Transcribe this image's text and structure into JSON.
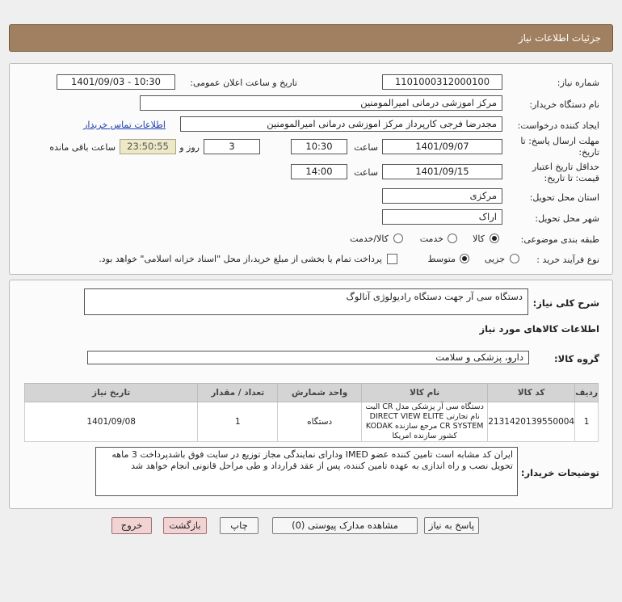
{
  "header": {
    "title": "جزئیات اطلاعات نیاز"
  },
  "form": {
    "need_number_label": "شماره نیاز:",
    "need_number": "1101000312000100",
    "announce_label": "تاریخ و ساعت اعلان عمومی:",
    "announce_value": "1401/09/03 - 10:30",
    "buyer_org_label": "نام دستگاه خریدار:",
    "buyer_org": "مرکز اموزشی درمانی امیرالمومنین",
    "creator_label": "ایجاد کننده درخواست:",
    "creator": "مجدرضا فرجی کارپرداز مرکز اموزشی درمانی امیرالمومنین",
    "contact_link": "اطلاعات تماس خریدار",
    "deadline_label_1": "مهلت ارسال پاسخ: تا",
    "deadline_label_2": "تاریخ:",
    "deadline_date": "1401/09/07",
    "time_label": "ساعت",
    "deadline_time": "10:30",
    "days": "3",
    "days_label": "روز و",
    "remaining": "23:50:55",
    "remaining_label": "ساعت باقی مانده",
    "validity_label_1": "حداقل تاریخ اعتبار",
    "validity_label_2": "قیمت: تا تاریخ:",
    "validity_date": "1401/09/15",
    "validity_time": "14:00",
    "province_label": "استان محل تحویل:",
    "province": "مرکزی",
    "city_label": "شهر محل تحویل:",
    "city": "اراک",
    "category_label": "طبقه بندی موضوعی:",
    "category_options": [
      "کالا",
      "خدمت",
      "کالا/خدمت"
    ],
    "process_label": "نوع فرآیند خرید :",
    "process_options": [
      "جزیی",
      "متوسط"
    ],
    "treasury_note": "پرداخت تمام یا بخشی از مبلغ خرید،از محل \"اسناد خزانه اسلامی\" خواهد بود."
  },
  "summary": {
    "label": "شرح کلی نیاز:",
    "value": "دستگاه سی آر جهت دستگاه رادیولوژی آنالوگ"
  },
  "goods": {
    "section_title": "اطلاعات کالاهای مورد نیاز",
    "group_label": "گروه کالا:",
    "group_value": "دارو، پزشکی و سلامت"
  },
  "table": {
    "headers": [
      "ردیف",
      "کد کالا",
      "نام کالا",
      "واحد شمارش",
      "تعداد / مقدار",
      "تاریخ نیاز"
    ],
    "rows": [
      {
        "row": "1",
        "code": "2131420139550004",
        "name": "دستگاه سی آر پزشکی مدل CR الیت نام تجارتی DIRECT VIEW ELITE CR SYSTEM مرجع سازنده KODAK کشور سازنده امریکا",
        "unit": "دستگاه",
        "qty": "1",
        "date": "1401/09/08"
      }
    ]
  },
  "buyer_notes": {
    "label": "توضیحات خریدار:",
    "value": "ایران کد مشابه است تامین کننده عضو IMED ودارای نمایندگی مجاز توزیع در سایت فوق باشدپرداخت 3 ماهه تحویل نصب و راه اندازی به عهده تامین کننده، پس از عقد قرارداد و طی مراحل قانونی انجام خواهد شد"
  },
  "buttons": {
    "reply": "پاسخ به نیاز",
    "attachments": "مشاهده مدارک پیوستی (0)",
    "print": "چاپ",
    "back": "بازگشت",
    "exit": "خروج"
  },
  "colors": {
    "header_bg": "#a08060",
    "link": "#1f3fb0",
    "exit_bg": "#f2d3d3"
  }
}
